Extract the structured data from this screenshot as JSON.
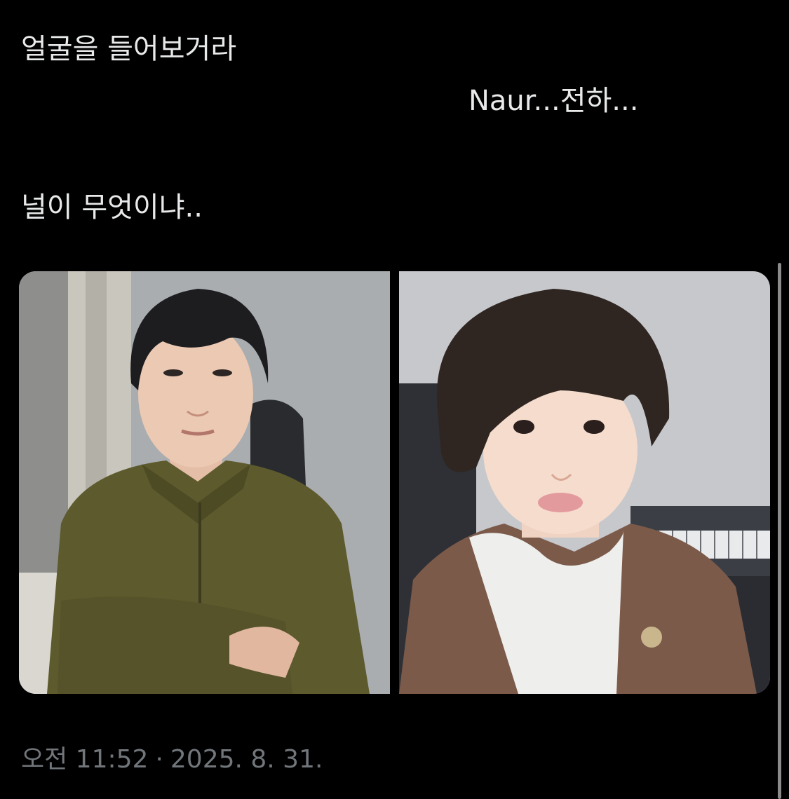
{
  "tweet": {
    "lines": [
      "얼굴을 들어보거라",
      "Naur...전하...",
      "널이 무엇이냐.."
    ]
  },
  "media": {
    "images": [
      {
        "icon": "photo-man-green-jacket"
      },
      {
        "icon": "photo-man-brown-cardigan"
      }
    ]
  },
  "meta": {
    "time": "오전 11:52",
    "separator": "·",
    "date": "2025. 8. 31."
  },
  "colors": {
    "background": "#000000",
    "text": "#e7e9ea",
    "muted": "#71767b"
  }
}
